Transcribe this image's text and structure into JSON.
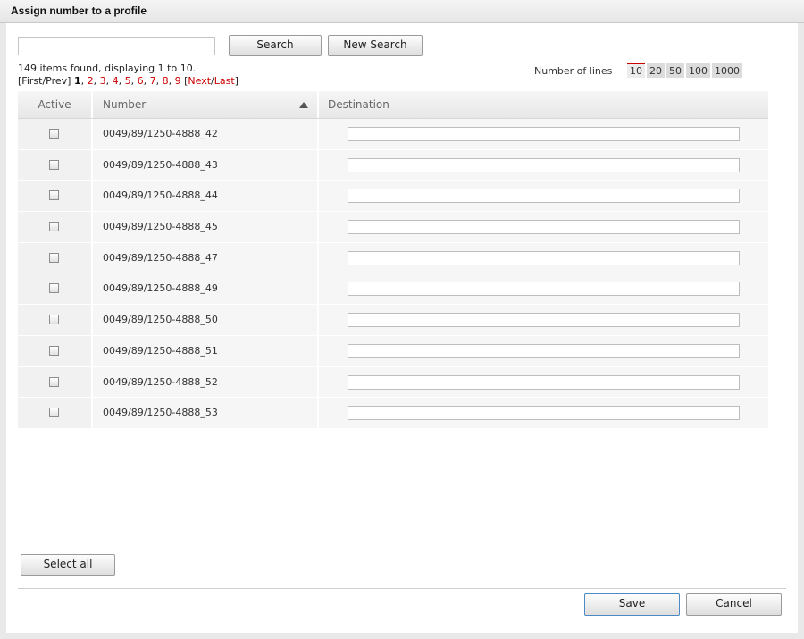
{
  "window": {
    "title": "Assign number to a profile"
  },
  "search": {
    "value": "",
    "search_label": "Search",
    "new_search_label": "New Search"
  },
  "results": {
    "info": "149 items found, displaying 1 to 10."
  },
  "pager": {
    "first_prev": "[First/Prev]",
    "current": "1",
    "pages": [
      "2",
      "3",
      "4",
      "5",
      "6",
      "7",
      "8",
      "9"
    ],
    "next_last_open": "[",
    "next": "Next",
    "slash": "/",
    "last": "Last",
    "next_last_close": "]"
  },
  "lines": {
    "label": "Number of lines",
    "options": [
      "10",
      "20",
      "50",
      "100",
      "1000"
    ],
    "selected": "10"
  },
  "table": {
    "columns": {
      "active": "Active",
      "number": "Number",
      "destination": "Destination"
    },
    "sort": {
      "column": "number",
      "direction": "ascending",
      "icon": "sort-up-icon"
    },
    "rows": [
      {
        "active": false,
        "number": "0049/89/1250-4888_42",
        "destination": ""
      },
      {
        "active": false,
        "number": "0049/89/1250-4888_43",
        "destination": ""
      },
      {
        "active": false,
        "number": "0049/89/1250-4888_44",
        "destination": ""
      },
      {
        "active": false,
        "number": "0049/89/1250-4888_45",
        "destination": ""
      },
      {
        "active": false,
        "number": "0049/89/1250-4888_47",
        "destination": ""
      },
      {
        "active": false,
        "number": "0049/89/1250-4888_49",
        "destination": ""
      },
      {
        "active": false,
        "number": "0049/89/1250-4888_50",
        "destination": ""
      },
      {
        "active": false,
        "number": "0049/89/1250-4888_51",
        "destination": ""
      },
      {
        "active": false,
        "number": "0049/89/1250-4888_52",
        "destination": ""
      },
      {
        "active": false,
        "number": "0049/89/1250-4888_53",
        "destination": ""
      }
    ]
  },
  "footer": {
    "select_all_label": "Select all",
    "save_label": "Save",
    "cancel_label": "Cancel"
  },
  "colors": {
    "link": "#cc0000",
    "save_border": "#4a8bc6",
    "header_bg": "#e7e7e7"
  }
}
